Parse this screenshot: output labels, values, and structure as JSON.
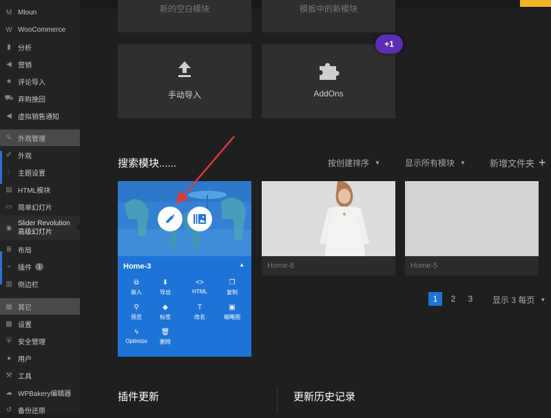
{
  "sidebar": {
    "items": [
      {
        "name": "sidebar-item-mloun",
        "icon": "m-logo-icon",
        "label": "Mloun"
      },
      {
        "name": "sidebar-item-woocommerce",
        "icon": "woocommerce-icon",
        "label": "WooCommerce"
      },
      {
        "name": "sidebar-item-analytics",
        "icon": "bar-chart-icon",
        "label": "分析"
      },
      {
        "name": "sidebar-item-marketing",
        "icon": "megaphone-icon",
        "label": "营销"
      },
      {
        "name": "sidebar-item-review-import",
        "icon": "star-icon",
        "label": "评论导入"
      },
      {
        "name": "sidebar-item-abandoned-cart",
        "icon": "cart-icon",
        "label": "弃购挽回"
      },
      {
        "name": "sidebar-item-fake-sales",
        "icon": "megaphone-icon",
        "label": "虚拟销售通知"
      },
      {
        "name": "sidebar-section-appearance",
        "icon": "brush-icon",
        "label": "外观管理"
      },
      {
        "name": "sidebar-item-appearance",
        "icon": "paintbrush-icon",
        "label": "外观"
      },
      {
        "name": "sidebar-item-theme-settings",
        "icon": "sliders-icon",
        "label": "主题设置"
      },
      {
        "name": "sidebar-item-html-modules",
        "icon": "html-icon",
        "label": "HTML模块"
      },
      {
        "name": "sidebar-item-simple-slider",
        "icon": "slides-icon",
        "label": "简单幻灯片"
      },
      {
        "name": "sidebar-item-slider-revolution",
        "icon": "revolution-icon",
        "label": "Slider Revolution",
        "label2": "高级幻灯片"
      },
      {
        "name": "sidebar-item-layout",
        "icon": "layers-icon",
        "label": "布局"
      },
      {
        "name": "sidebar-item-plugins",
        "icon": "plug-icon",
        "label": "插件",
        "badge": "1"
      },
      {
        "name": "sidebar-item-sidebars",
        "icon": "sidebar-icon",
        "label": "侧边栏"
      },
      {
        "name": "sidebar-section-other",
        "icon": "grid-icon",
        "label": "其它"
      },
      {
        "name": "sidebar-item-settings",
        "icon": "settings-icon",
        "label": "设置"
      },
      {
        "name": "sidebar-item-security",
        "icon": "shield-icon",
        "label": "安全管理"
      },
      {
        "name": "sidebar-item-users",
        "icon": "user-icon",
        "label": "用户"
      },
      {
        "name": "sidebar-item-tools",
        "icon": "wrench-icon",
        "label": "工具"
      },
      {
        "name": "sidebar-item-wpbakery",
        "icon": "cloud-icon",
        "label": "WPBakery编辑器"
      },
      {
        "name": "sidebar-item-backup",
        "icon": "restore-icon",
        "label": "备份还原"
      }
    ]
  },
  "top_tiles": {
    "tile1_cut_label": "新的空白模块",
    "tile2_cut_label": "模板中的新模块",
    "manual_import_label": "手动导入",
    "addons_label": "AddOns",
    "addons_badge": "+1"
  },
  "search": {
    "title": "搜索模块......",
    "sort_label": "按创建排序",
    "filter_label": "显示所有模块",
    "new_folder_label": "新增文件夹",
    "add_symbol": "+"
  },
  "modules": [
    {
      "title": "Home-3"
    },
    {
      "title": "Home-8"
    },
    {
      "title": "Home-5"
    }
  ],
  "module_actions": [
    {
      "icon": "embed-icon",
      "glyph": "⧉",
      "label": "嵌入"
    },
    {
      "icon": "export-icon",
      "glyph": "⬇",
      "label": "导出"
    },
    {
      "icon": "code-icon",
      "glyph": "<>",
      "label": "HTML"
    },
    {
      "icon": "copy-icon",
      "glyph": "❐",
      "label": "复制"
    },
    {
      "icon": "search-icon",
      "glyph": "⚲",
      "label": "预览"
    },
    {
      "icon": "tag-icon",
      "glyph": "◆",
      "label": "标签"
    },
    {
      "icon": "text-icon",
      "glyph": "T",
      "label": "改名"
    },
    {
      "icon": "image-icon",
      "glyph": "▣",
      "label": "缩略图"
    },
    {
      "icon": "bolt-icon",
      "glyph": "ϟ",
      "label": "Optimize"
    },
    {
      "icon": "trash-icon",
      "glyph": "🗑",
      "label": "删除"
    }
  ],
  "pagination": {
    "pages": [
      "1",
      "2",
      "3"
    ],
    "active": "1",
    "per_page_label": "显示 3 每页"
  },
  "bottom": {
    "plugin_updates_title": "插件更新",
    "update_history_title": "更新历史记录"
  },
  "colors": {
    "accent_blue": "#1e74d6",
    "badge_purple": "#5b2fb1",
    "annotation_arrow": "#e03a3a"
  }
}
